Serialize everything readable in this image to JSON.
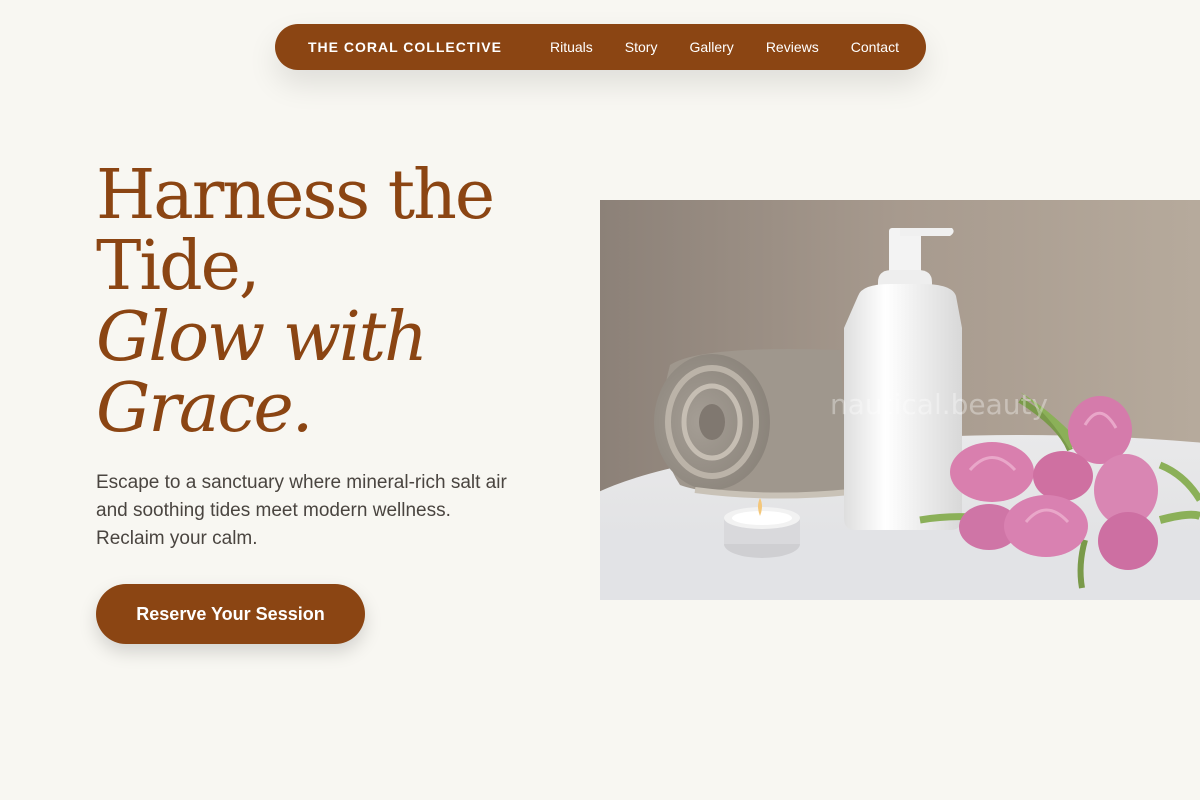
{
  "nav": {
    "brand": "THE CORAL COLLECTIVE",
    "links": [
      "Rituals",
      "Story",
      "Gallery",
      "Reviews",
      "Contact"
    ]
  },
  "hero": {
    "headline_line1": "Harness the",
    "headline_line2": "Tide,",
    "headline_line3": "Glow with",
    "headline_line4": "Grace.",
    "description": "Escape to a sanctuary where mineral-rich salt air and soothing tides meet modern wellness. Reclaim your calm.",
    "cta_label": "Reserve Your Session",
    "image_watermark": "nautical.beauty"
  },
  "colors": {
    "accent": "#8b4513",
    "background": "#f8f7f2",
    "body_text": "#4a4540"
  },
  "icons": [
    "spa-photo"
  ]
}
